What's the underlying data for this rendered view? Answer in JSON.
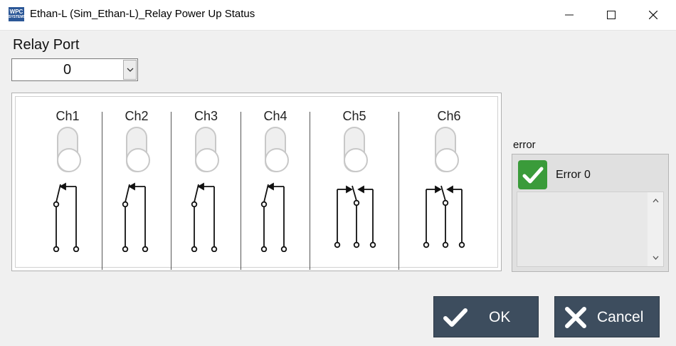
{
  "window": {
    "title": "Ethan-L (Sim_Ethan-L)_Relay Power Up Status",
    "app_icon_text": "WPC",
    "app_icon_subtext": "SYSTEMS"
  },
  "relay_port": {
    "label": "Relay Port",
    "value": "0"
  },
  "channels": [
    {
      "label": "Ch1",
      "type": "SPST",
      "state": "off"
    },
    {
      "label": "Ch2",
      "type": "SPST",
      "state": "off"
    },
    {
      "label": "Ch3",
      "type": "SPST",
      "state": "off"
    },
    {
      "label": "Ch4",
      "type": "SPST",
      "state": "off"
    },
    {
      "label": "Ch5",
      "type": "SPDT",
      "state": "off"
    },
    {
      "label": "Ch6",
      "type": "SPDT",
      "state": "off"
    }
  ],
  "error": {
    "label": "error",
    "message": "Error 0",
    "status_color": "#3a9b3a"
  },
  "buttons": {
    "ok": "OK",
    "cancel": "Cancel"
  },
  "colors": {
    "button_bg": "#3d4d5e",
    "led_off": "#efefef"
  }
}
